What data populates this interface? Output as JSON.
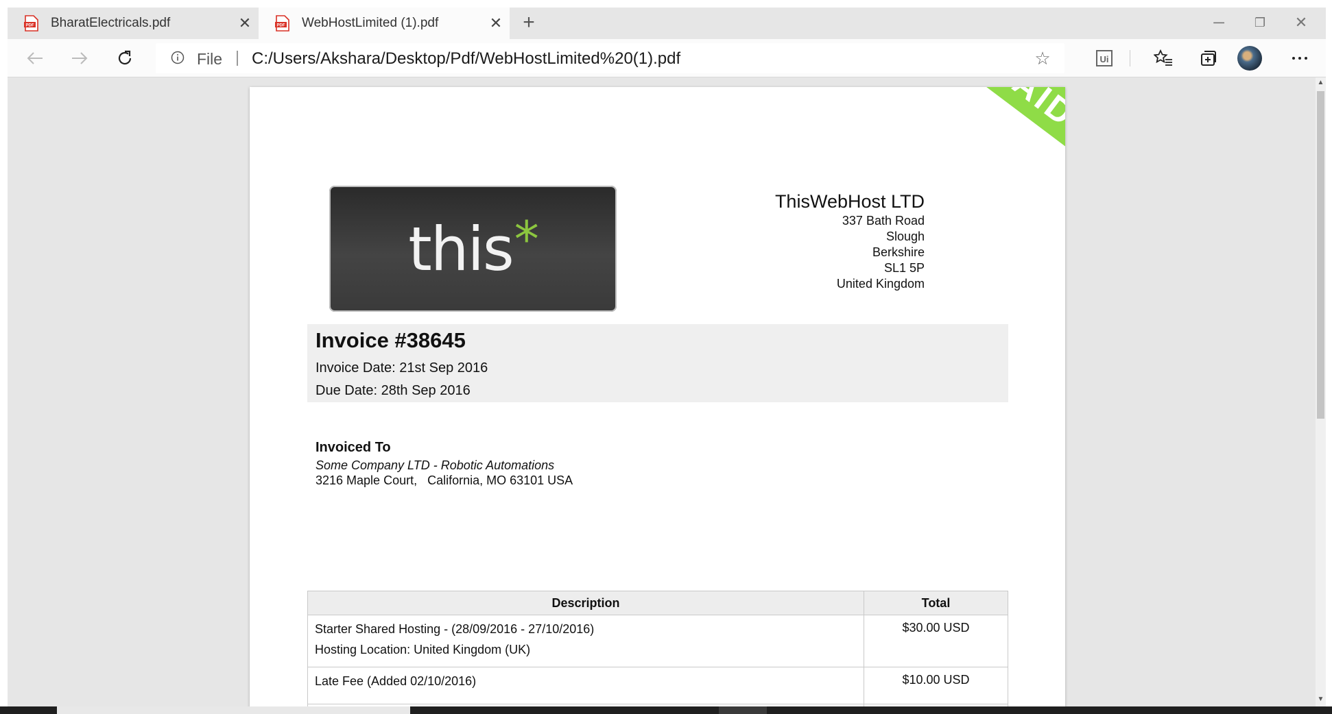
{
  "tabs": [
    {
      "title": "BharatElectricals.pdf",
      "active": false
    },
    {
      "title": "WebHostLimited (1).pdf",
      "active": true
    }
  ],
  "address": {
    "scheme_label": "File",
    "url": "C:/Users/Akshara/Desktop/Pdf/WebHostLimited%20(1).pdf"
  },
  "document": {
    "stamp": "PAID",
    "logo": {
      "word": "this",
      "mark": "*"
    },
    "company": {
      "name": "ThisWebHost LTD",
      "address_lines": [
        "337 Bath Road",
        "Slough",
        "Berkshire",
        "SL1 5P",
        "United Kingdom"
      ]
    },
    "invoice": {
      "title": "Invoice #38645",
      "date": "Invoice Date: 21st Sep 2016",
      "due": "Due Date: 28th Sep 2016"
    },
    "billed_to": {
      "heading": "Invoiced To",
      "company": "Some Company LTD - Robotic Automations",
      "address": "3216 Maple Court,   California, MO 63101 USA"
    },
    "items_table": {
      "headers": [
        "Description",
        "Total"
      ],
      "rows": [
        {
          "desc_lines": [
            "Starter Shared Hosting - (28/09/2016 - 27/10/2016)",
            "Hosting Location: United Kingdom (UK)"
          ],
          "total": "$30.00 USD"
        },
        {
          "desc_lines": [
            "Late Fee (Added 02/10/2016)"
          ],
          "total": "$10.00 USD"
        }
      ]
    }
  },
  "colors": {
    "stamp_green": "#8fdc47",
    "logo_star": "#8cc63f",
    "pdf_icon_red": "#d93025"
  },
  "icons": [
    "pdf-icon",
    "close-icon",
    "plus-icon",
    "minimize-icon",
    "restore-icon",
    "window-close-icon",
    "back-arrow-icon",
    "forward-arrow-icon",
    "refresh-icon",
    "info-icon",
    "star-icon",
    "ui-extension-icon",
    "favorites-icon",
    "collections-icon",
    "more-icon"
  ]
}
